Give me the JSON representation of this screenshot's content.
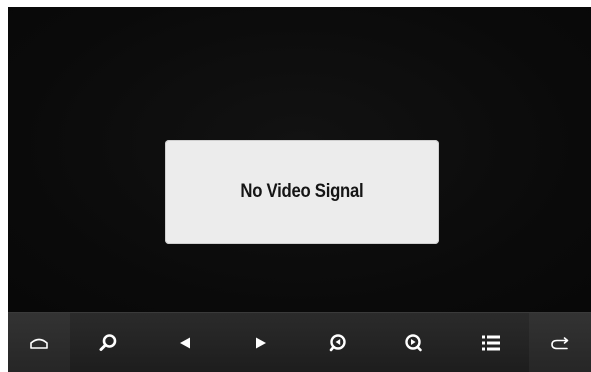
{
  "message": {
    "text": "No Video Signal"
  },
  "toolbar": {
    "buttons": [
      {
        "name": "home-icon"
      },
      {
        "name": "search-icon"
      },
      {
        "name": "previous-icon"
      },
      {
        "name": "next-icon"
      },
      {
        "name": "zoom-out-icon"
      },
      {
        "name": "zoom-in-icon"
      },
      {
        "name": "list-icon"
      },
      {
        "name": "back-icon"
      }
    ]
  },
  "colors": {
    "screen_background": "#0b0b0b",
    "dialog_background": "#ececec",
    "toolbar_background": "#222222",
    "icon_color": "#ffffff"
  }
}
